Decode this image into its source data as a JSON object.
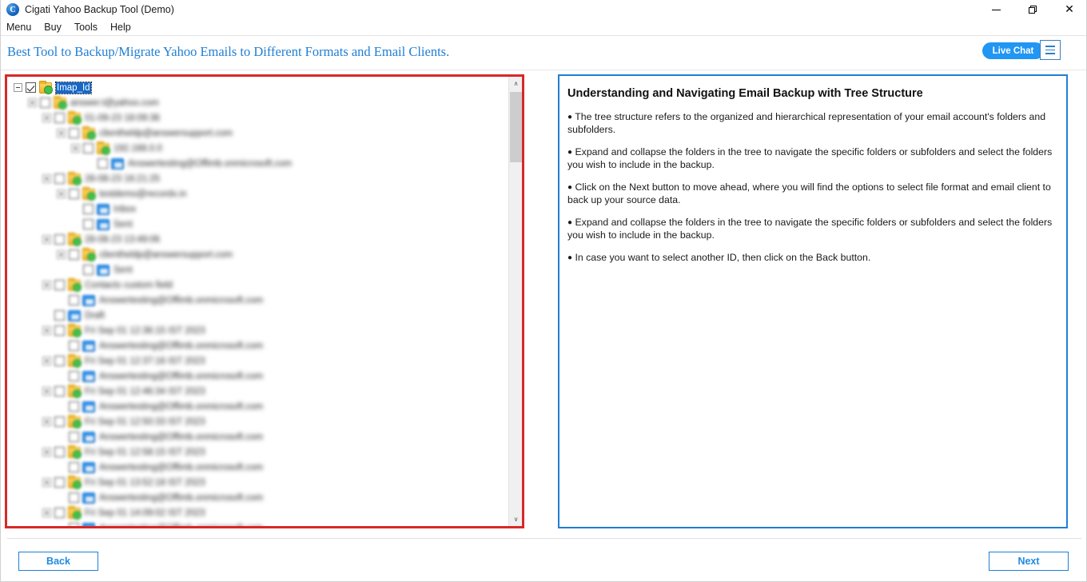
{
  "window": {
    "title": "Cigati Yahoo Backup Tool (Demo)",
    "logo_letter": "C",
    "controls": {
      "minimize": "Minimize",
      "restore": "Restore",
      "close": "Close"
    }
  },
  "menubar": {
    "items": [
      {
        "label": "Menu"
      },
      {
        "label": "Buy"
      },
      {
        "label": "Tools"
      },
      {
        "label": "Help"
      }
    ]
  },
  "banner": {
    "tagline": "Best Tool to Backup/Migrate Yahoo Emails to Different Formats and Email Clients.",
    "live_chat_label": "Live Chat",
    "menu_icon": "hamburger-icon",
    "accent_color": "#1f7fd4",
    "live_chat_color": "#2196f3"
  },
  "tree_panel": {
    "border_color": "#d82828",
    "selected_node": "Imap_Id",
    "scrollbar": {
      "up_arrow": "∧",
      "down_arrow": "∨"
    },
    "nodes": [
      {
        "depth": 0,
        "expander": "minus",
        "checked": true,
        "icon": "folder-check-icon",
        "label": "Imap_Id",
        "selected": true,
        "blurred": false
      },
      {
        "depth": 1,
        "expander": "plus",
        "checked": false,
        "icon": "folder-check-icon",
        "label": "answer.t@yahoo.com",
        "selected": false,
        "blurred": true
      },
      {
        "depth": 2,
        "expander": "plus",
        "checked": false,
        "icon": "folder-check-icon",
        "label": "01-09-23 18:09:36",
        "selected": false,
        "blurred": true
      },
      {
        "depth": 3,
        "expander": "plus",
        "checked": false,
        "icon": "folder-check-icon",
        "label": "clientheldp@answersupport.com",
        "selected": false,
        "blurred": true
      },
      {
        "depth": 4,
        "expander": "plus",
        "checked": false,
        "icon": "folder-check-icon",
        "label": "192.168.0.0",
        "selected": false,
        "blurred": true
      },
      {
        "depth": 5,
        "expander": "none",
        "checked": false,
        "icon": "mail-icon",
        "label": "Answertesting@Offimb.onmicrosoft.com",
        "selected": false,
        "blurred": true
      },
      {
        "depth": 2,
        "expander": "plus",
        "checked": false,
        "icon": "folder-check-icon",
        "label": "28-08-23 16:21:25",
        "selected": false,
        "blurred": true
      },
      {
        "depth": 3,
        "expander": "plus",
        "checked": false,
        "icon": "folder-check-icon",
        "label": "testdemo@recordx.in",
        "selected": false,
        "blurred": true
      },
      {
        "depth": 4,
        "expander": "none",
        "checked": false,
        "icon": "mail-icon",
        "label": "Inbox",
        "selected": false,
        "blurred": true
      },
      {
        "depth": 4,
        "expander": "none",
        "checked": false,
        "icon": "mail-icon",
        "label": "Sent",
        "selected": false,
        "blurred": true
      },
      {
        "depth": 2,
        "expander": "plus",
        "checked": false,
        "icon": "folder-check-icon",
        "label": "28-08-23 13:49:06",
        "selected": false,
        "blurred": true
      },
      {
        "depth": 3,
        "expander": "plus",
        "checked": false,
        "icon": "folder-check-icon",
        "label": "clientheldp@answersupport.com",
        "selected": false,
        "blurred": true
      },
      {
        "depth": 4,
        "expander": "none",
        "checked": false,
        "icon": "mail-icon",
        "label": "Sent",
        "selected": false,
        "blurred": true
      },
      {
        "depth": 2,
        "expander": "plus",
        "checked": false,
        "icon": "folder-check-icon",
        "label": "Contacts custom field",
        "selected": false,
        "blurred": true
      },
      {
        "depth": 3,
        "expander": "none",
        "checked": false,
        "icon": "mail-icon",
        "label": "Answertesting@Offimb.onmicrosoft.com",
        "selected": false,
        "blurred": true
      },
      {
        "depth": 2,
        "expander": "none",
        "checked": false,
        "icon": "mail-icon",
        "label": "Draft",
        "selected": false,
        "blurred": true
      },
      {
        "depth": 2,
        "expander": "plus",
        "checked": false,
        "icon": "folder-check-icon",
        "label": "Fri Sep 01 12:36:15 IST 2023",
        "selected": false,
        "blurred": true
      },
      {
        "depth": 3,
        "expander": "none",
        "checked": false,
        "icon": "mail-icon",
        "label": "Answertesting@Offimb.onmicrosoft.com",
        "selected": false,
        "blurred": true
      },
      {
        "depth": 2,
        "expander": "plus",
        "checked": false,
        "icon": "folder-check-icon",
        "label": "Fri Sep 01 12:37:16 IST 2023",
        "selected": false,
        "blurred": true
      },
      {
        "depth": 3,
        "expander": "none",
        "checked": false,
        "icon": "mail-icon",
        "label": "Answertesting@Offimb.onmicrosoft.com",
        "selected": false,
        "blurred": true
      },
      {
        "depth": 2,
        "expander": "plus",
        "checked": false,
        "icon": "folder-check-icon",
        "label": "Fri Sep 01 12:46:34 IST 2023",
        "selected": false,
        "blurred": true
      },
      {
        "depth": 3,
        "expander": "none",
        "checked": false,
        "icon": "mail-icon",
        "label": "Answertesting@Offimb.onmicrosoft.com",
        "selected": false,
        "blurred": true
      },
      {
        "depth": 2,
        "expander": "plus",
        "checked": false,
        "icon": "folder-check-icon",
        "label": "Fri Sep 01 12:50:33 IST 2023",
        "selected": false,
        "blurred": true
      },
      {
        "depth": 3,
        "expander": "none",
        "checked": false,
        "icon": "mail-icon",
        "label": "Answertesting@Offimb.onmicrosoft.com",
        "selected": false,
        "blurred": true
      },
      {
        "depth": 2,
        "expander": "plus",
        "checked": false,
        "icon": "folder-check-icon",
        "label": "Fri Sep 01 12:58:15 IST 2023",
        "selected": false,
        "blurred": true
      },
      {
        "depth": 3,
        "expander": "none",
        "checked": false,
        "icon": "mail-icon",
        "label": "Answertesting@Offimb.onmicrosoft.com",
        "selected": false,
        "blurred": true
      },
      {
        "depth": 2,
        "expander": "plus",
        "checked": false,
        "icon": "folder-check-icon",
        "label": "Fri Sep 01 13:52:18 IST 2023",
        "selected": false,
        "blurred": true
      },
      {
        "depth": 3,
        "expander": "none",
        "checked": false,
        "icon": "mail-icon",
        "label": "Answertesting@Offimb.onmicrosoft.com",
        "selected": false,
        "blurred": true
      },
      {
        "depth": 2,
        "expander": "plus",
        "checked": false,
        "icon": "folder-check-icon",
        "label": "Fri Sep 01 14:09:02 IST 2023",
        "selected": false,
        "blurred": true
      },
      {
        "depth": 3,
        "expander": "none",
        "checked": false,
        "icon": "mail-icon",
        "label": "Answertesting@Offimb.onmicrosoft.com",
        "selected": false,
        "blurred": true
      }
    ]
  },
  "info_panel": {
    "border_color": "#1f7fd4",
    "title": "Understanding and Navigating Email Backup with Tree Structure",
    "items": [
      "The tree structure refers to the organized and hierarchical representation of your email account's folders and subfolders.",
      "Expand and collapse the folders in the tree to navigate the specific folders or subfolders and select the folders you wish to include in the backup.",
      "Click on the Next button to move ahead, where you will find the options to select file format and email client to back up your source data.",
      "Expand and collapse the folders in the tree to navigate the specific folders or subfolders and select the folders you wish to include in the backup.",
      "In case you want to select another ID, then click on the Back button."
    ]
  },
  "footer": {
    "back_label": "Back",
    "next_label": "Next"
  }
}
